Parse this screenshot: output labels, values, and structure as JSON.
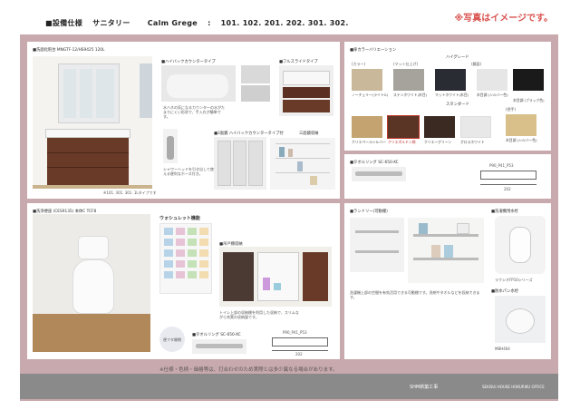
{
  "header": {
    "title_prefix": "■設備仕様",
    "product": "サニタリー",
    "color_name": "Calm Grege",
    "separator": ":",
    "rooms": "101. 102. 201. 202. 301. 302.",
    "note": "※写真はイメージです。"
  },
  "vanity": {
    "title": "■洗面化粧台 MNGTF-12/HS9425 120L",
    "size_note": "※101. 301. 301. 1Lタイプです",
    "faucet_title": "■ハイバックカウンタータイプ",
    "faucet_desc": "水ハネの気になるカウンターの水がたまりにくい形状で、手入れが簡単です。",
    "slide_title": "■フルスライドタイプ",
    "storage_title": "■3面鏡 ハイバックカウンタータイプ付",
    "storage_label": "三面鏡収納",
    "hose_desc": "シャワーヘッドを引き出して使える便利なホース付き。"
  },
  "door_color": {
    "title": "■扉カラーバリエーション",
    "grade_high": "ハイグレード",
    "grade_std": "スタンダード",
    "swatches_top": [
      {
        "label": "ノーチェリー(ライトG)",
        "color": "#c9b89a"
      },
      {
        "label": "ステンホワイト(木目)",
        "color": "#a6a39c"
      },
      {
        "label": "マットホワイト(木目)",
        "color": "#2a2c33"
      },
      {
        "label": "木目調 (シルバー色)",
        "color": "#e6e6e6"
      },
      {
        "label": "木目調 (ブラック色)",
        "color": "#1a1a1a"
      }
    ],
    "swatches_bottom": [
      {
        "label": "クリエペールシルバー",
        "color": "#c4a370"
      },
      {
        "label": "クリエボルドン柄",
        "color": "#5a3526"
      },
      {
        "label": "クリエーグリーン",
        "color": "#3a2a22"
      },
      {
        "label": "グロスホワイト",
        "color": "#e8e8e8"
      },
      {
        "label": "木目調 (シルバー色)",
        "color": "#d9c08a"
      }
    ],
    "col_titles": [
      "(カラー)",
      "(マット仕上げ)",
      "(鏡面)",
      "(把手)"
    ]
  },
  "towel_bar_top": {
    "title": "■タオルリング SC-650-XC",
    "dims": "P90_P41_P53",
    "width": "202"
  },
  "toilet": {
    "title": "■洗浄便座 (CES9135) 本体C TCF8",
    "washlet_title": "ウォシュレット機能",
    "caption": "■トイレ上部の収納棚を利用した便利な収納。",
    "storage_title": "■吊戸棚収納",
    "storage_desc": "トイレ上部の収納棚を利用した収納で、スリムながら充実の収納量です。",
    "remote_note": "便フタ開閉"
  },
  "towel_bar_bottom": {
    "title": "■タオルリング SC-650-XC",
    "dims": "P90_P41_P53",
    "width": "202"
  },
  "laundry": {
    "title": "■ランドリー(可動棚)",
    "desc": "洗濯機上部の空間を有効活用できる可動棚です。洗剤やタオルなどを収納できます。",
    "faucet_title": "■洗濯機用水栓",
    "faucet_model": "ラクシオFP10シリーズ",
    "drain_title": "■防水パン水栓",
    "drain_model": "MBH404"
  },
  "footer": {
    "disclaimer": "※仕様・色柄・価格等は、打合わせのため実際とは多少異なる場合があります。",
    "company": "SHM新築工事",
    "office": "SEKISUI HOUSE HOKURIKU OFFICE"
  }
}
